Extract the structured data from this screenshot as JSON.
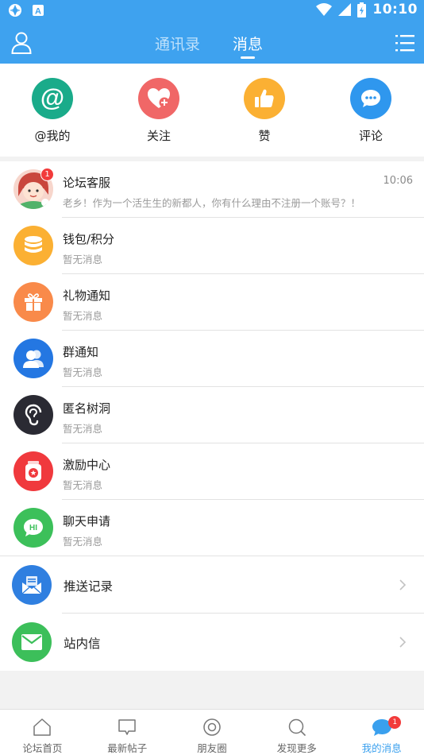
{
  "status_bar": {
    "time": "10:10",
    "icons": [
      "app-icon",
      "notification-a-icon",
      "wifi-icon",
      "signal-icon",
      "battery-icon"
    ]
  },
  "header": {
    "tabs": [
      {
        "label": "通讯录",
        "active": false
      },
      {
        "label": "消息",
        "active": true
      }
    ],
    "left_icon": "user-icon",
    "right_icon": "list-menu-icon",
    "color": "#3ea2ef"
  },
  "quick_actions": [
    {
      "label": "@我的",
      "icon": "at-icon",
      "color": "#1aab8a"
    },
    {
      "label": "关注",
      "icon": "heart-plus-icon",
      "color": "#f06767"
    },
    {
      "label": "赞",
      "icon": "thumbs-up-icon",
      "color": "#fbb033"
    },
    {
      "label": "评论",
      "icon": "chat-dots-icon",
      "color": "#2f97ee"
    }
  ],
  "messages": [
    {
      "title": "论坛客服",
      "subtitle": "老乡！作为一个活生生的新都人，你有什么理由不注册一个账号？！",
      "time": "10:06",
      "badge": "1",
      "icon": "customer-service-avatar"
    },
    {
      "title": "钱包/积分",
      "subtitle": "暂无消息",
      "icon": "coins-icon",
      "color": "#fbb033"
    },
    {
      "title": "礼物通知",
      "subtitle": "暂无消息",
      "icon": "gift-icon",
      "color": "#f98a4a"
    },
    {
      "title": "群通知",
      "subtitle": "暂无消息",
      "icon": "group-icon",
      "color": "#2477e2"
    },
    {
      "title": "匿名树洞",
      "subtitle": "暂无消息",
      "icon": "ear-icon",
      "color": "#2a2a33"
    },
    {
      "title": "激励中心",
      "subtitle": "暂无消息",
      "icon": "medal-icon",
      "color": "#f0393d"
    },
    {
      "title": "聊天申请",
      "subtitle": "暂无消息",
      "icon": "hi-chat-icon",
      "color": "#3cc05a"
    }
  ],
  "links": [
    {
      "title": "推送记录",
      "icon": "push-mail-icon",
      "color": "#2f7fe0"
    },
    {
      "title": "站内信",
      "icon": "envelope-icon",
      "color": "#3cbf5a"
    }
  ],
  "bottom_tabs": [
    {
      "label": "论坛首页",
      "icon": "home-icon",
      "active": false
    },
    {
      "label": "最新帖子",
      "icon": "post-icon",
      "active": false
    },
    {
      "label": "朋友圈",
      "icon": "moments-icon",
      "active": false
    },
    {
      "label": "发现更多",
      "icon": "search-icon",
      "active": false
    },
    {
      "label": "我的消息",
      "icon": "message-bubble-icon",
      "active": true,
      "badge": "1"
    }
  ]
}
